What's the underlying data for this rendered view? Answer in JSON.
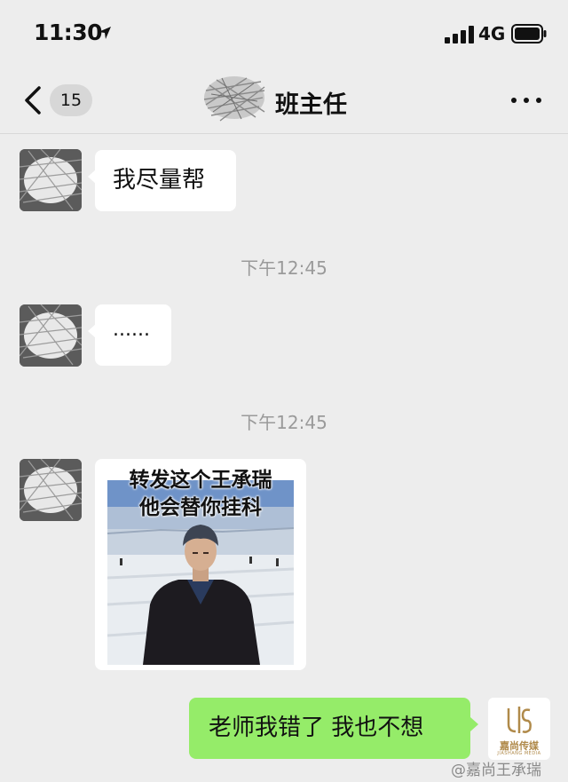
{
  "status_bar": {
    "time": "11:30",
    "network": "4G"
  },
  "nav": {
    "unread_count": "15",
    "title": "班主任"
  },
  "messages": [
    {
      "text": "我尽量帮"
    },
    {
      "text": "......"
    },
    {
      "image_caption_line1": "转发这个王承瑞",
      "image_caption_line2": "他会替你挂科"
    },
    {
      "text": "老师我错了 我也不想"
    }
  ],
  "timestamps": [
    "下午12:45",
    "下午12:45"
  ],
  "my_avatar": {
    "brand": "嘉尚传媒",
    "brand_en": "JIASHANG MEDIA"
  },
  "watermark": "@嘉尚王承瑞",
  "colors": {
    "background": "#ededed",
    "sent_bubble": "#95ec69",
    "received_bubble": "#ffffff",
    "timestamp": "#9a9a9a"
  }
}
